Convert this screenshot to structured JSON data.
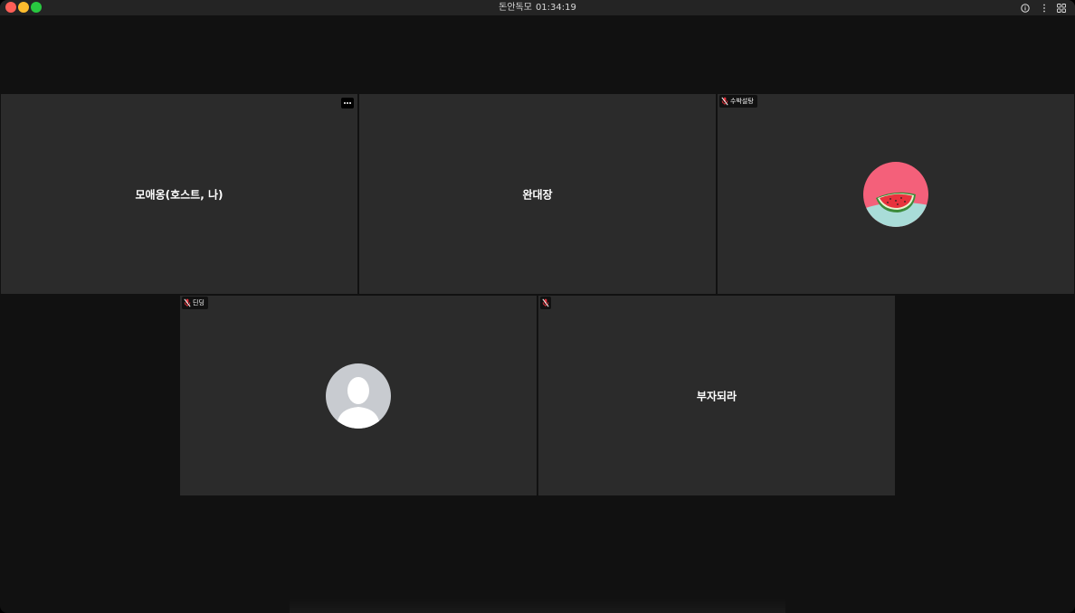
{
  "window": {
    "title_prefix": "돈안독모",
    "timer": "01:34:19"
  },
  "icons": {
    "info": "info-icon",
    "more": "more-vertical-icon",
    "layout": "grid-layout-icon",
    "mic_muted": "mic-muted-icon",
    "tile_menu": "more-horizontal-icon"
  },
  "colors": {
    "tile_bg": "#2b2b2b",
    "muted_red": "#e0313b",
    "watermelon_bg": "#f4607a",
    "default_avatar_bg": "#c8cbd0"
  },
  "participants": [
    {
      "name": "모애옹(호스트, 나)",
      "badge": "",
      "muted": false,
      "avatar": "none"
    },
    {
      "name": "완대장",
      "badge": "",
      "muted": false,
      "avatar": "none"
    },
    {
      "name": "",
      "badge": "수박설탕",
      "muted": true,
      "avatar": "watermelon"
    },
    {
      "name": "",
      "badge": "딘딩",
      "muted": true,
      "avatar": "default-person"
    },
    {
      "name": "부자되라",
      "badge": "",
      "muted": true,
      "avatar": "none"
    }
  ]
}
